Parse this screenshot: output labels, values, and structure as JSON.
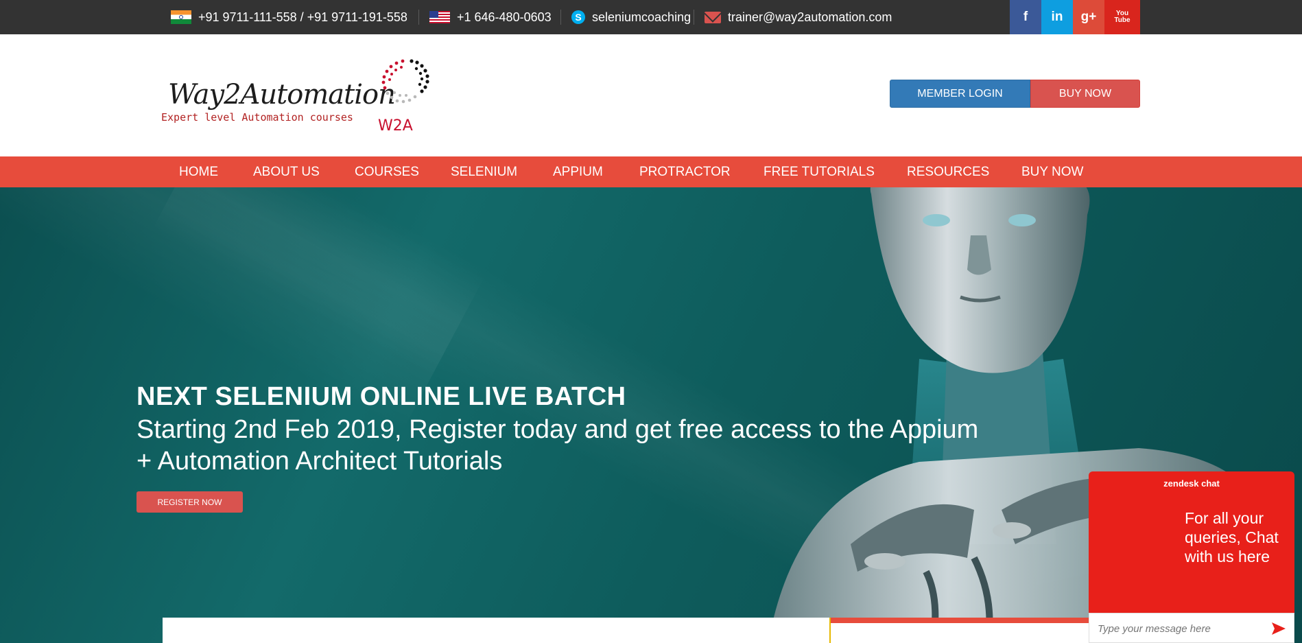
{
  "topbar": {
    "phone_india": "+91 9711-111-558 / +91 9711-191-558",
    "phone_us": "+1 646-480-0603",
    "skype": "seleniumcoaching",
    "email": "trainer@way2automation.com",
    "social": {
      "facebook": "f",
      "linkedin": "in",
      "googleplus": "g+",
      "youtube": "You Tube"
    },
    "colors": {
      "facebook": "#3b5998",
      "linkedin": "#0e9ee0",
      "googleplus": "#dd4b39",
      "youtube": "#d9251d"
    }
  },
  "header": {
    "logo_text": "Way2Automation",
    "logo_tagline": "Expert level Automation courses",
    "logo_mark_text": "W2A",
    "member_login": "MEMBER LOGIN",
    "buy_now": "BUY NOW"
  },
  "nav": {
    "items": [
      "HOME",
      "ABOUT US",
      "COURSES",
      "SELENIUM",
      "APPIUM",
      "PROTRACTOR",
      "FREE TUTORIALS",
      "RESOURCES",
      "BUY NOW"
    ]
  },
  "hero": {
    "title": "NEXT SELENIUM ONLINE LIVE BATCH",
    "subtitle": "Starting 2nd Feb 2019, Register today and get free access to the Appium + Automation Architect Tutorials",
    "button": "REGISTER NOW"
  },
  "chat": {
    "header": "zendesk chat",
    "message": "For all your queries, Chat with us here",
    "input_placeholder": "Type your message here"
  }
}
